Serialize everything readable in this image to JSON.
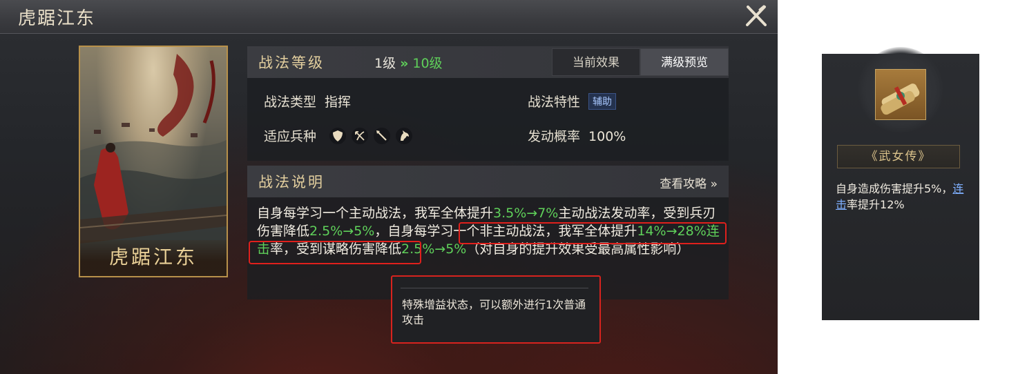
{
  "window": {
    "title": "虎踞江东"
  },
  "card": {
    "name": "虎踞江东"
  },
  "level": {
    "section_title": "战法等级",
    "current": "1级",
    "arrow": "»",
    "max": "10级",
    "tabs": [
      {
        "label": "当前效果",
        "active": false
      },
      {
        "label": "满级预览",
        "active": true
      }
    ]
  },
  "attributes": {
    "type_label": "战法类型",
    "type_value": "指挥",
    "trait_label": "战法特性",
    "trait_value": "辅助",
    "troops_label": "适应兵种",
    "troop_icons": [
      "shield-icon",
      "bow-icon",
      "spear-icon",
      "horse-icon"
    ],
    "chance_label": "发动概率",
    "chance_value": "100%"
  },
  "description": {
    "section_title": "战法说明",
    "guide_link": "查看攻略 »",
    "segments": [
      {
        "text": "自身每学习一个主动战法，我军全体提升",
        "green": false
      },
      {
        "text": "3.5%→7%",
        "green": true
      },
      {
        "text": "主动战法发动率，受到兵刃伤害降低",
        "green": false
      },
      {
        "text": "2.5%→5%",
        "green": true
      },
      {
        "text": "，自身每学习一个非主动战法，我军全体提升",
        "green": false
      },
      {
        "text": "14%→28%连击",
        "green": true
      },
      {
        "text": "率，受到谋略伤害降低",
        "green": false
      },
      {
        "text": "2.5%→5%",
        "green": true
      },
      {
        "text": "（对自身的提升效果受最高属性影响）",
        "green": false
      }
    ]
  },
  "tooltip": {
    "text": "特殊增益状态，可以额外进行1次普通攻击"
  },
  "side_panel": {
    "tactic_name": "《武女传》",
    "effect_prefix": "自身造成伤害提升5%，",
    "effect_link": "连击",
    "effect_suffix": "率提升12%"
  },
  "colors": {
    "accent_green": "#5fd05a",
    "highlight_red": "#e0201c",
    "gold": "#e3cf9e",
    "link_blue": "#7fb0ff"
  }
}
